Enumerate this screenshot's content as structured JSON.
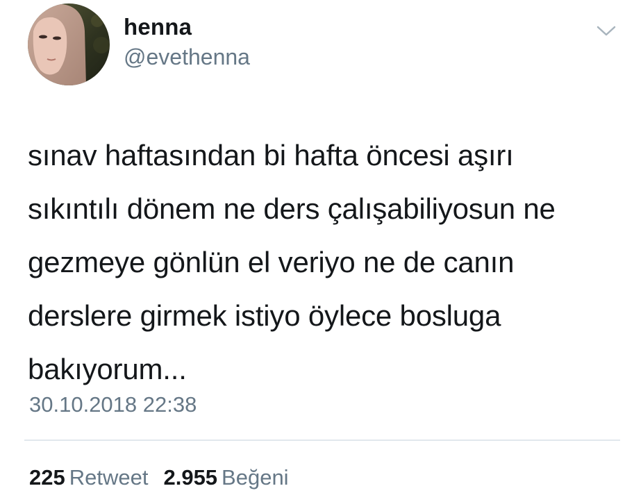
{
  "user": {
    "display_name": "henna",
    "handle": "@evethenna",
    "avatar_icon": "profile-photo"
  },
  "menu": {
    "icon": "chevron-down-icon"
  },
  "tweet": {
    "lines": [
      "sınav haftasından bi hafta öncesi aşırı",
      "sıkıntılı dönem ne ders çalışabiliyosun ne",
      "gezmeye gönlün el veriyo ne de canın",
      "derslere girmek istiyo öylece bosluga",
      "bakıyorum..."
    ],
    "timestamp": "30.10.2018 22:38"
  },
  "stats": {
    "retweets": {
      "count": "225",
      "label": "Retweet"
    },
    "likes": {
      "count": "2.955",
      "label": "Beğeni"
    }
  },
  "colors": {
    "text": "#14171a",
    "secondary": "#657786",
    "divider": "#e1e8ed"
  }
}
